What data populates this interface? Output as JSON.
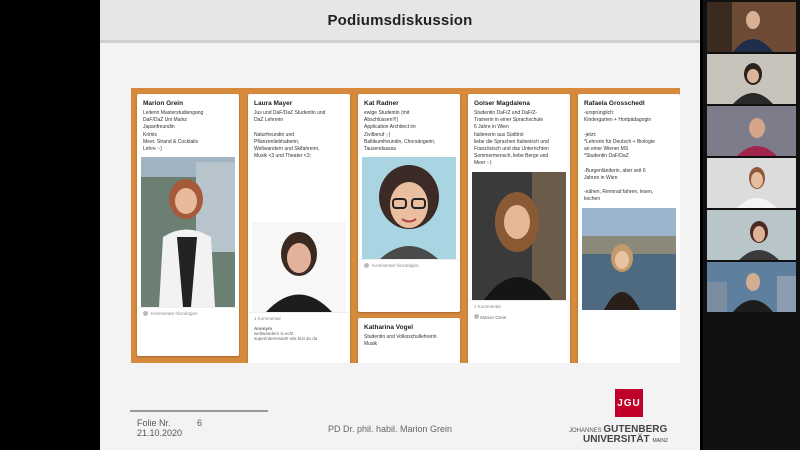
{
  "slide": {
    "title": "Podiumsdiskussion",
    "footer": {
      "label": "Folie Nr.",
      "number": "6",
      "date": "21.10.2020",
      "author": "PD Dr. phil. habil. Marion Grein"
    },
    "logo": {
      "mark": "JGU",
      "line1_prefix": "JOHANNES",
      "line1_main": "GUTENBERG",
      "line2_main": "UNIVERSITÄT",
      "line2_suffix": "MAINZ"
    }
  },
  "cards": [
    {
      "name": "Marion Grein",
      "lines": [
        "Leiterin Masterstudiengang",
        "DaF/DaZ Uni Mainz",
        "Japanfreundin",
        "Krimis",
        "Meer, Strand & Cocktails",
        "Lehre :-)"
      ],
      "footer": "Kommentar hinzufügen"
    },
    {
      "name": "Laura Mayer",
      "lines": [
        "Jus und DaF/DaZ Studentin und",
        "DaZ Lehrerin",
        "",
        "Naturfreundin und",
        "Pflanzenliebhaberin,",
        "Weltwandern und Skifahrerin,",
        "Musik <3 und Theater <3;"
      ],
      "comment_count": "1 Kommentar",
      "comment_author": "Anonym",
      "comment_lines": [
        "weltwandern is echt",
        "superinteressant! wie bist du da"
      ]
    },
    {
      "name": "Kat Radner",
      "lines": [
        "ewige Studentin (mit",
        "Abschlüssen!!!)",
        "Application Architect im",
        "Zivilberuf ;-)",
        "Baltikumfreundin, Chorsängerin,",
        "Tausendsassa"
      ],
      "footer": "Kommentar hinzufügen"
    },
    {
      "name": "Katharina Vogel",
      "lines": [
        "Studentin und Volksschullehrerin",
        "Musik"
      ]
    },
    {
      "name": "Golser Magdalena",
      "lines": [
        "Studentin DaF/Z und DaF/Z-",
        "Trainerin in einer Sprachschule",
        "6 Jahre in Wien",
        "Italienerin aus Südtirol",
        "liebe die Sprachen Italienisch und",
        "Französisch und das Unterrichten",
        "Sommermensch, liebe Berge und",
        "Meer :-)"
      ],
      "comment_count": "1 Kommentar",
      "comment_author": "Marion Grein"
    },
    {
      "name": "Rafaela Grosschedl",
      "lines": [
        "-ursprünglich:",
        "Kindergarten + Hortpädagogin",
        "",
        "-jetzt:",
        "*Lehrerin für Deutsch + Biologie",
        "an einer Wiener MS",
        "*Studentin DaF/DaZ",
        "",
        "-Burgenländerin, aber seit 6",
        "Jahren in Wien",
        "",
        "-nähen, Rennrad fahren, lesen,",
        "kochen"
      ]
    }
  ],
  "add_button": "+",
  "icons": [
    "comment-icon",
    "plus-icon",
    "avatar-icon"
  ],
  "colors": {
    "board": "#d78a3c",
    "jgu_red": "#c1002a",
    "plus_button": "#e84a7a"
  }
}
